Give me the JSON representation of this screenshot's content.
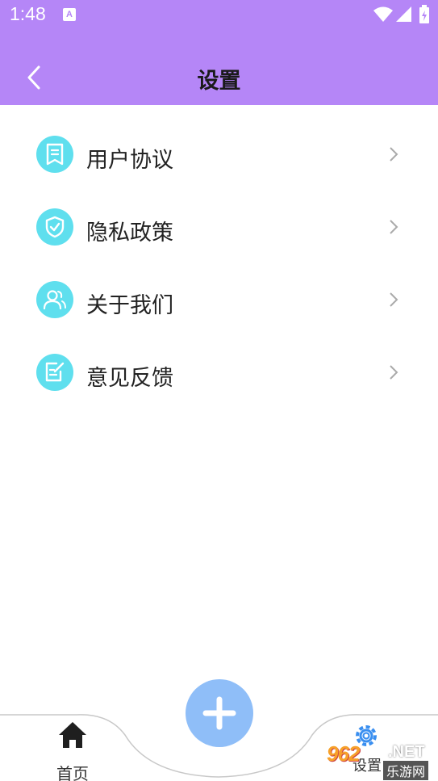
{
  "status_bar": {
    "time": "1:48",
    "notification_icon": "A"
  },
  "header": {
    "title": "设置",
    "back_icon": "chevron-left-icon"
  },
  "menu": {
    "items": [
      {
        "label": "用户协议",
        "icon": "document-icon"
      },
      {
        "label": "隐私政策",
        "icon": "shield-check-icon"
      },
      {
        "label": "关于我们",
        "icon": "users-icon"
      },
      {
        "label": "意见反馈",
        "icon": "edit-note-icon"
      }
    ]
  },
  "tabbar": {
    "home_label": "首页",
    "settings_label": "设置",
    "add_icon": "plus-icon"
  },
  "watermark": {
    "logo_text": "962",
    "net_text": ".NET",
    "site_text": "乐游网"
  },
  "colors": {
    "header": "#b586f7",
    "icon_bg": "#5fdfee",
    "add_button": "#8fbef8"
  }
}
